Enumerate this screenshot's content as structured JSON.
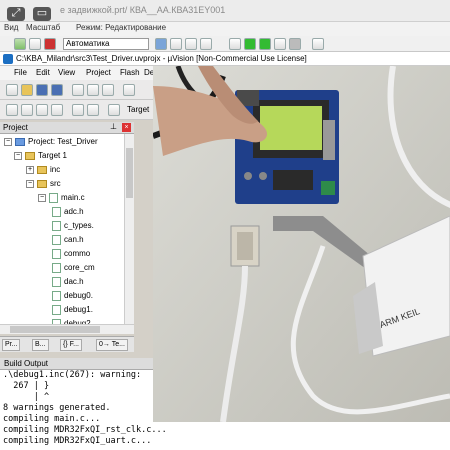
{
  "outer": {
    "title": "е задвижкой.prt/ КВА__АА.КВА31ЕY001",
    "menu": [
      "Вид",
      "Масштаб",
      "Режим: Редактирование"
    ],
    "combo_value": "Автоматика"
  },
  "overlay_icons": [
    "expand-icon",
    "pip-icon"
  ],
  "uvision": {
    "title": "C:\\KBA_Milandr\\src3\\Test_Driver.uvprojx - µVision  [Non-Commercial Use License]",
    "menu": [
      "File",
      "Edit",
      "View",
      "Project",
      "Flash",
      "De"
    ],
    "target_label": "Target"
  },
  "project": {
    "header": "Project",
    "tree": [
      {
        "label": "Project: Test_Driver",
        "level": 0,
        "type": "project",
        "expander": "−"
      },
      {
        "label": "Target 1",
        "level": 1,
        "type": "folder",
        "expander": "−"
      },
      {
        "label": "inc",
        "level": 2,
        "type": "folder",
        "expander": "+"
      },
      {
        "label": "src",
        "level": 2,
        "type": "folder",
        "expander": "−"
      },
      {
        "label": "main.c",
        "level": 3,
        "type": "file",
        "expander": "−"
      },
      {
        "label": "adc.h",
        "level": 4,
        "type": "file"
      },
      {
        "label": "c_types.",
        "level": 4,
        "type": "file"
      },
      {
        "label": "can.h",
        "level": 4,
        "type": "file"
      },
      {
        "label": "commo",
        "level": 4,
        "type": "file"
      },
      {
        "label": "core_cm",
        "level": 4,
        "type": "file"
      },
      {
        "label": "dac.h",
        "level": 4,
        "type": "file"
      },
      {
        "label": "debug0.",
        "level": 4,
        "type": "file"
      },
      {
        "label": "debug1.",
        "level": 4,
        "type": "file"
      },
      {
        "label": "debug2.",
        "level": 4,
        "type": "file"
      }
    ],
    "tabs": [
      "Pr...",
      "B...",
      "{} F...",
      "0→ Te..."
    ]
  },
  "build": {
    "header": "Build Output",
    "lines": [
      ".\\debug1.inc(267): warning:",
      "  267 | }",
      "      | ^",
      "8 warnings generated.",
      "compiling main.c...",
      "compiling MDR32FxQI_rst_clk.c...",
      "compiling MDR32FxQI_uart.c..."
    ]
  },
  "video": {
    "lcd_color": "#b6d85a",
    "board_color": "#1f3f8a",
    "device_brand": "ARM KEIL"
  }
}
